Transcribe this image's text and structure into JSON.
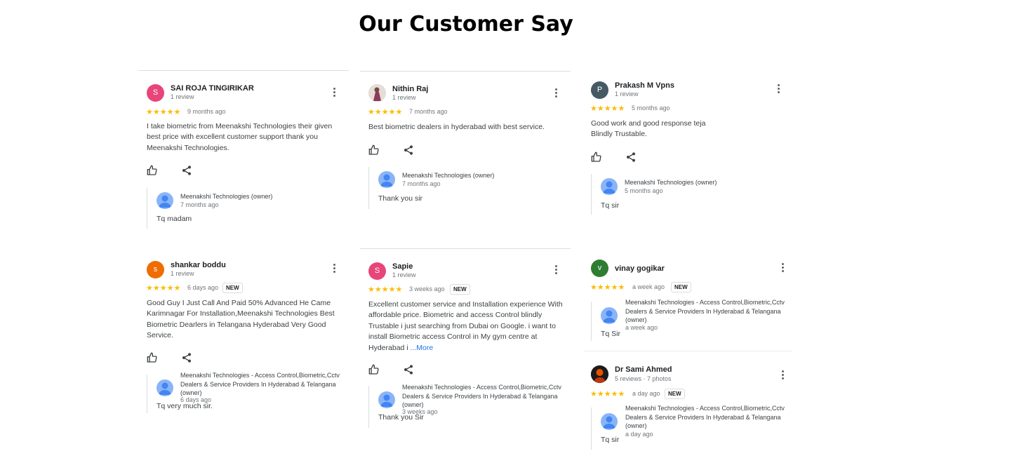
{
  "page_title": "Our Customer Say",
  "reviews": [
    {
      "name": "SAI ROJA TINGIRIKAR",
      "meta": "1 review",
      "avatar_letter": "S",
      "avatar_color": "#e8457a",
      "rating": "★★★★★",
      "time": "9 months ago",
      "text": "I take biometric from Meenakshi Technologies their given best price with excellent customer support thank you Meenakshi Technologies.",
      "owner": "Meenakshi Technologies (owner)",
      "owner_time": "7 months ago",
      "reply": "Tq madam"
    },
    {
      "name": "Nithin Raj",
      "meta": "1 review",
      "rating": "★★★★★",
      "time": "7 months ago",
      "text": "Best biometric dealers in hyderabad with best service.",
      "owner": "Meenakshi Technologies (owner)",
      "owner_time": "7 months ago",
      "reply": "Thank you sir"
    },
    {
      "name": "Prakash M Vpns",
      "meta": "1 review",
      "avatar_letter": "P",
      "avatar_color": "#455a64",
      "rating": "★★★★★",
      "time": "5 months ago",
      "text": "Good work and good response teja Blindly Trustable.",
      "owner": "Meenakshi Technologies (owner)",
      "owner_time": "5 months ago",
      "reply": "Tq sir"
    },
    {
      "name": "shankar boddu",
      "meta": "1 review",
      "avatar_letter": "s",
      "avatar_color": "#ef6c00",
      "rating": "★★★★★",
      "time": "6 days ago",
      "badge": "NEW",
      "text": "Good Guy I Just Call And Paid 50% Advanced He Came Karimnagar For Installation,Meenakshi Technologies Best Biometric Dearlers in Telangana Hyderabad Very Good Service.",
      "owner": "Meenakshi Technologies - Access Control,Biometric,Cctv Dealers & Service Providers In Hyderabad & Telangana (owner)",
      "owner_time": "6 days ago",
      "reply": "Tq very much sir."
    },
    {
      "name": "Sapie",
      "meta": "1 review",
      "avatar_letter": "S",
      "avatar_color": "#e8457a",
      "rating": "★★★★★",
      "time": "3 weeks ago",
      "badge": "NEW",
      "text": "Excellent customer service and Installation experience With affordable price. Biometric and access Control blindly Trustable i just searching from Dubai on Google. i want to install Biometric access Control in My gym centre at Hyderabad i",
      "more": "...More",
      "owner": "Meenakshi Technologies - Access Control,Biometric,Cctv Dealers & Service Providers In Hyderabad & Telangana (owner)",
      "owner_time": "3 weeks ago",
      "reply": "Thank you Sir"
    },
    {
      "name": "vinay gogikar",
      "avatar_letter": "v",
      "avatar_color": "#2e7d32",
      "rating": "★★★★★",
      "time": "a week ago",
      "badge": "NEW",
      "owner": "Meenakshi Technologies - Access Control,Biometric,Cctv Dealers & Service Providers In Hyderabad & Telangana (owner)",
      "owner_time": "a week ago",
      "reply": "Tq Sir"
    },
    {
      "name": "Dr Sami Ahmed",
      "meta": "5 reviews · 7 photos",
      "rating": "★★★★★",
      "time": "a day ago",
      "badge": "NEW",
      "owner": "Meenakshi Technologies - Access Control,Biometric,Cctv Dealers & Service Providers In Hyderabad & Telangana (owner)",
      "owner_time": "a day ago",
      "reply": "Tq sir"
    }
  ]
}
